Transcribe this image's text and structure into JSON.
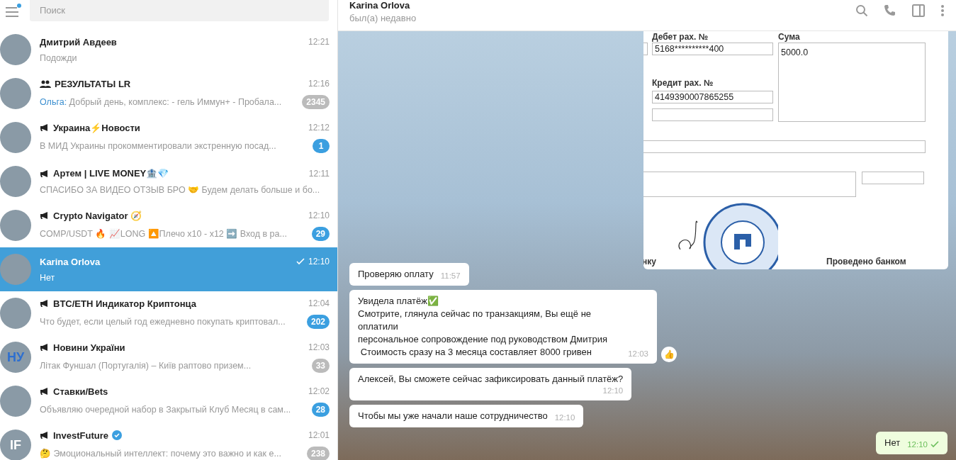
{
  "search": {
    "placeholder": "Поиск"
  },
  "menu": {
    "unread_dot": true
  },
  "chats": [
    {
      "kind": "user",
      "name": "Дмитрий Авдеев",
      "time": "12:21",
      "preview": "Подожди",
      "selected": false
    },
    {
      "kind": "group",
      "name": "РЕЗУЛЬТАТЫ LR",
      "time": "12:16",
      "sender": "Ольга:",
      "preview": "Добрый день, комплекс:  - гель Иммун+ - Пробала...",
      "badge": "2345",
      "muted": true,
      "selected": false
    },
    {
      "kind": "channel",
      "name": "Украина⚡Новости",
      "time": "12:12",
      "preview": "В МИД Украины прокомментировали экстренную посад...",
      "badge": "1",
      "muted": false,
      "selected": false
    },
    {
      "kind": "channel",
      "name": "Артем | LIVE MONEY🏦💎",
      "time": "12:11",
      "preview": "СПАСИБО ЗА ВИДЕО ОТЗЫВ БРО 🤝  Будем делать больше и бо...",
      "selected": false
    },
    {
      "kind": "channel",
      "name": "Crypto Navigator 🧭",
      "time": "12:10",
      "preview": "COMP/USDT 🔥  📈LONG 🔼Плечо x10 - x12  ➡️ Вход в ра...",
      "badge": "29",
      "muted": false,
      "selected": false
    },
    {
      "kind": "user",
      "name": "Karina Orlova",
      "time": "12:10",
      "preview": "Нет",
      "read": true,
      "selected": true
    },
    {
      "kind": "channel",
      "name": "BTC/ETH Индикатор Криптонца",
      "time": "12:04",
      "preview": "Что будет, если целый год ежедневно покупать криптовал...",
      "badge": "202",
      "muted": false,
      "selected": false
    },
    {
      "kind": "channel",
      "name": "Новини України",
      "time": "12:03",
      "preview": "Літак Фуншал (Португалія) – Київ раптово призем...",
      "badge": "33",
      "muted": true,
      "selected": false,
      "avatar_text": "НУ"
    },
    {
      "kind": "channel",
      "name": "Ставки/Bets",
      "time": "12:02",
      "preview": "Объявляю очередной набор в Закрытый Клуб  Месяц в сам...",
      "badge": "28",
      "muted": false,
      "selected": false
    },
    {
      "kind": "channel",
      "name": "InvestFuture",
      "verified": true,
      "time": "12:01",
      "preview": "🤔 Эмоциональный интеллект: почему это важно и как е...",
      "badge": "238",
      "muted": true,
      "selected": false,
      "avatar_text": "IF"
    }
  ],
  "chat": {
    "title": "Karina Orlova",
    "status": "был(а) недавно"
  },
  "document": {
    "debit_label": "Дебет рах. №",
    "debit_value": "5168**********400",
    "sum_label": "Сума",
    "sum_value": "5000.0",
    "credit_label": "Кредит рах. №",
    "credit_value": "4149390007865255",
    "left_caption": "нку",
    "right_caption": "Проведено банком"
  },
  "messages": [
    {
      "kind": "incoming",
      "text": "Проверяю оплату",
      "time": "11:57"
    },
    {
      "kind": "incoming",
      "text": "Увидела платёж✅\nСмотрите, глянула сейчас по транзакциям, Вы ещё не оплатили\nперсональное сопровождение под руководством Дмитрия\n Стоимость сразу на 3 месяца составляет 8000 гривен",
      "time": "12:03",
      "reaction": "👍"
    },
    {
      "kind": "incoming",
      "text": "Алексей, Вы сможете сейчас зафиксировать данный платёж?",
      "time": "12:10",
      "time_below": true
    },
    {
      "kind": "incoming",
      "text": "Чтобы мы уже начали наше сотрудничество",
      "time": "12:10"
    },
    {
      "kind": "outgoing",
      "text": "Нет",
      "time": "12:10",
      "read": true
    }
  ]
}
